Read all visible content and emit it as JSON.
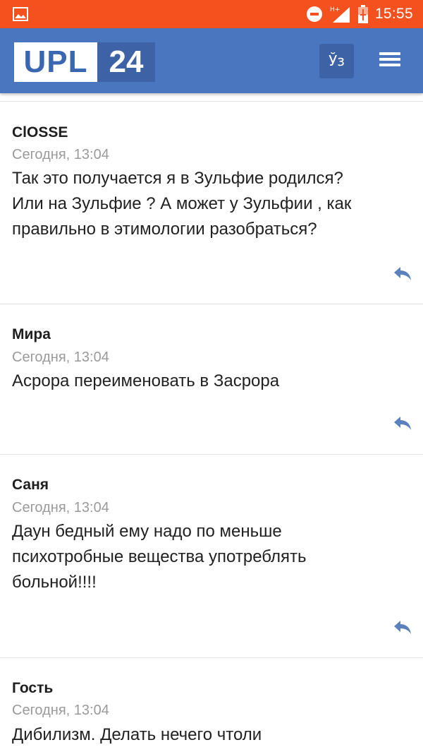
{
  "status_bar": {
    "time": "15:55",
    "network": "H+",
    "icons": [
      "image-icon",
      "do-not-disturb-icon",
      "signal-icon",
      "battery-charging-icon"
    ]
  },
  "header": {
    "logo_left": "UPL",
    "logo_right": "24",
    "lang_button": "Ўз",
    "menu_icon": "hamburger-menu-icon",
    "colors": {
      "header_bg": "#4a76c0",
      "status_bg": "#f4511e",
      "accent": "#3d62a6"
    }
  },
  "comments": [
    {
      "author": "ClOSSE",
      "date": "Сегодня, 13:04",
      "text_lines": [
        "Так это получается я в Зульфие родился?",
        "Или на Зульфие ? А может у Зульфии , как",
        "правильно в этимологии разобраться?"
      ],
      "reply_icon": "reply-icon"
    },
    {
      "author": "Мира",
      "date": "Сегодня, 13:04",
      "text_lines": [
        "Асрора переименовать в Засрора"
      ],
      "reply_icon": "reply-icon"
    },
    {
      "author": "Саня",
      "date": "Сегодня, 13:04",
      "text_lines": [
        "Даун бедный ему надо по меньше",
        "психотробные вещества употреблять",
        "больной!!!!"
      ],
      "reply_icon": "reply-icon"
    },
    {
      "author": "Гость",
      "date": "Сегодня, 13:04",
      "text_lines": [
        "Дибилизм. Делать нечего чтоли"
      ],
      "reply_icon": "reply-icon"
    }
  ]
}
